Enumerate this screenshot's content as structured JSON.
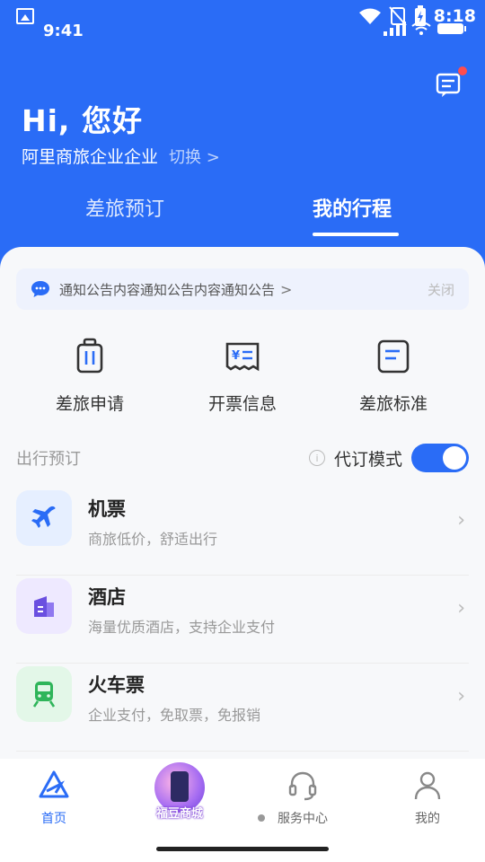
{
  "status": {
    "left_time": "9:41",
    "right_time": "8:18"
  },
  "header": {
    "greeting": "Hi, 您好",
    "company": "阿里商旅企业企业",
    "switch_label": "切换 >"
  },
  "tabs": [
    {
      "label": "差旅预订"
    },
    {
      "label": "我的行程"
    }
  ],
  "notice": {
    "text": "通知公告内容通知公告内容通知公告",
    "chev": ">",
    "close": "关闭"
  },
  "quick_actions": [
    {
      "label": "差旅申请",
      "icon": "suitcase-icon"
    },
    {
      "label": "开票信息",
      "icon": "invoice-icon"
    },
    {
      "label": "差旅标准",
      "icon": "policy-icon"
    }
  ],
  "section": {
    "title": "出行预订",
    "mode_label": "代订模式",
    "toggle_on": true
  },
  "services": [
    {
      "title": "机票",
      "subtitle": "商旅低价，舒适出行",
      "icon": "plane-icon",
      "bg": "#e6efff"
    },
    {
      "title": "酒店",
      "subtitle": "海量优质酒店，支持企业支付",
      "icon": "hotel-icon",
      "bg": "#eee9ff"
    },
    {
      "title": "火车票",
      "subtitle": "企业支付，免取票，免报销",
      "icon": "train-icon",
      "bg": "#e3f7e8"
    }
  ],
  "tabbar": [
    {
      "label": "首页"
    },
    {
      "label": "福豆商城"
    },
    {
      "label": "服务中心"
    },
    {
      "label": "我的"
    }
  ],
  "colors": {
    "primary": "#2a6cf6",
    "badge": "#ff4d4f"
  }
}
